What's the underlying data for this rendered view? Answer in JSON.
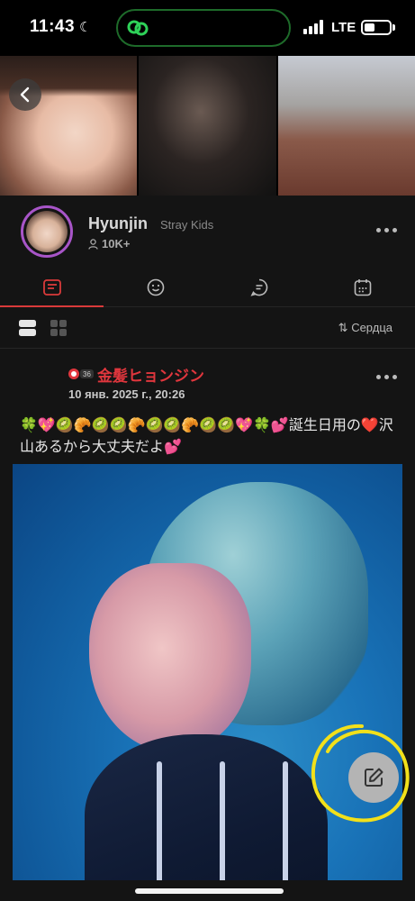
{
  "status": {
    "time": "11:43",
    "network": "LTE"
  },
  "profile": {
    "name": "Hyunjin",
    "group": "Stray Kids",
    "followers": "10K+"
  },
  "tabs": [
    {
      "id": "feed",
      "icon": "feed-icon",
      "active": true
    },
    {
      "id": "emoji",
      "icon": "smiley-icon",
      "active": false
    },
    {
      "id": "chat",
      "icon": "chat-bubble-icon",
      "active": false
    },
    {
      "id": "calendar",
      "icon": "calendar-icon",
      "active": false
    }
  ],
  "toolbar": {
    "sort_label": "Сердца"
  },
  "post": {
    "flair_number": "36",
    "title": "金髪ヒョンジン",
    "date": "10 янв. 2025 г., 20:26",
    "text": "🍀💖🥝🥐🥝🥝🥐🥝🥝🥐🥝🥝💖🍀💕誕生日用の❤️沢山あるから大丈夫だよ💕"
  },
  "colors": {
    "accent": "#d93a3a",
    "title": "#e0363d",
    "avatar_ring": "#a855c8",
    "island_ring": "#1e6b2a",
    "highlight": "#f2e01a"
  }
}
